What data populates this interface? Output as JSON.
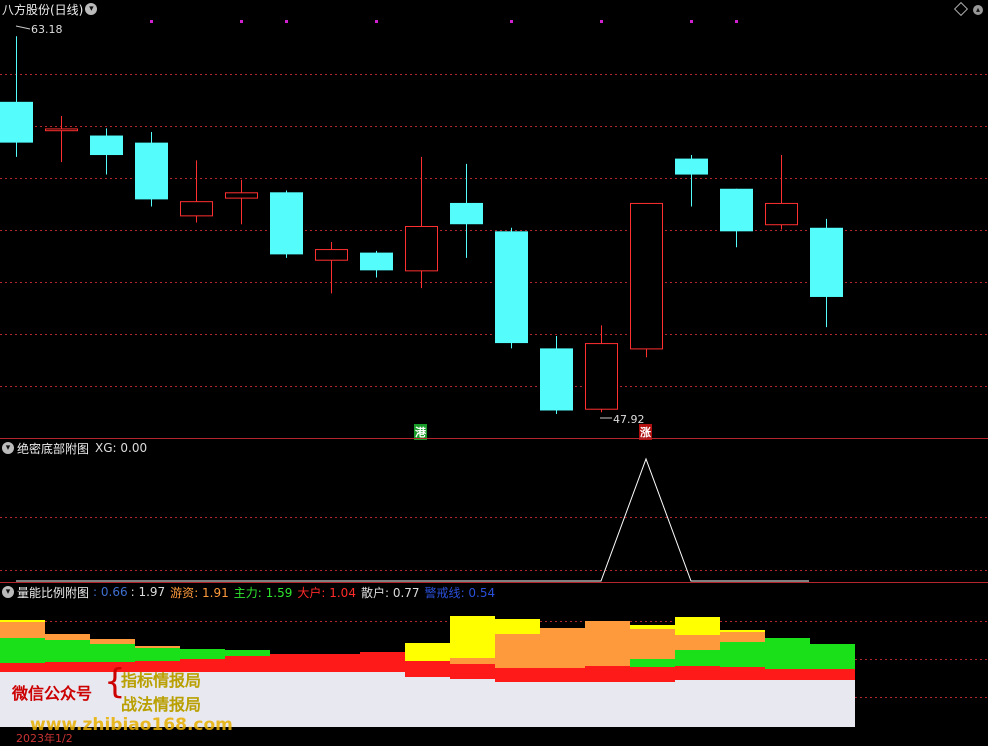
{
  "main_panel": {
    "title": "八方股份(日线)",
    "high_label": "63.18",
    "low_label": "47.92",
    "signal_gang": "港",
    "signal_zhang": "涨"
  },
  "sub_panel_1": {
    "title": "绝密底部附图",
    "xg_label": "XG: 0.00"
  },
  "sub_panel_2": {
    "title": "量能比例附图",
    "values": [
      {
        "label": "",
        "value": "0.66",
        "color": "#3f6fd0"
      },
      {
        "label": "",
        "value": "1.97",
        "color": "#dddddd"
      },
      {
        "label": "游资",
        "value": "1.91",
        "color": "#ff9a3c"
      },
      {
        "label": "主力",
        "value": "1.59",
        "color": "#2ee62e"
      },
      {
        "label": "大户",
        "value": "1.04",
        "color": "#ff2a2a"
      },
      {
        "label": "散户",
        "value": "0.77",
        "color": "#dddddd"
      },
      {
        "label": "警戒线",
        "value": "0.54",
        "color": "#2a4fd8"
      }
    ]
  },
  "watermark": {
    "line1": "微信公众号",
    "brace": "{",
    "line2a": "指标情报局",
    "line2b": "战法情报局",
    "site": "www.zhibiao168.com"
  },
  "date_label": "2023年1/2",
  "chart_data": {
    "type": "candlestick",
    "title": "八方股份(日线)",
    "candles": [
      {
        "open": 57.2,
        "close": 59.5,
        "high": 63.2,
        "low": 56.4,
        "dir": "down"
      },
      {
        "open": 58.0,
        "close": 57.9,
        "high": 58.7,
        "low": 56.1,
        "dir": "up"
      },
      {
        "open": 56.5,
        "close": 57.6,
        "high": 58.0,
        "low": 55.4,
        "dir": "down"
      },
      {
        "open": 54.0,
        "close": 57.2,
        "high": 57.8,
        "low": 53.6,
        "dir": "down"
      },
      {
        "open": 53.1,
        "close": 53.9,
        "high": 56.2,
        "low": 52.7,
        "dir": "up"
      },
      {
        "open": 54.1,
        "close": 54.4,
        "high": 55.1,
        "low": 52.6,
        "dir": "up"
      },
      {
        "open": 50.9,
        "close": 54.4,
        "high": 54.5,
        "low": 50.7,
        "dir": "down"
      },
      {
        "open": 50.6,
        "close": 51.2,
        "high": 51.6,
        "low": 48.7,
        "dir": "up"
      },
      {
        "open": 50.0,
        "close": 51.0,
        "high": 51.1,
        "low": 49.6,
        "dir": "down"
      },
      {
        "open": 50.0,
        "close": 52.5,
        "high": 56.4,
        "low": 49.0,
        "dir": "up"
      },
      {
        "open": 52.6,
        "close": 53.8,
        "high": 56.0,
        "low": 50.7,
        "dir": "down"
      },
      {
        "open": 45.9,
        "close": 52.2,
        "high": 52.4,
        "low": 45.6,
        "dir": "down"
      },
      {
        "open": 42.1,
        "close": 45.6,
        "high": 46.3,
        "low": 41.9,
        "dir": "down"
      },
      {
        "open": 42.2,
        "close": 45.9,
        "high": 46.9,
        "low": 42.0,
        "dir": "up"
      },
      {
        "open": 45.6,
        "close": 53.8,
        "high": 53.8,
        "low": 45.1,
        "dir": "up"
      },
      {
        "open": 55.4,
        "close": 56.3,
        "high": 56.5,
        "low": 53.6,
        "dir": "down"
      },
      {
        "open": 52.2,
        "close": 54.6,
        "high": 54.6,
        "low": 51.3,
        "dir": "down"
      },
      {
        "open": 52.6,
        "close": 53.8,
        "high": 56.5,
        "low": 52.3,
        "dir": "up"
      },
      {
        "open": 48.5,
        "close": 52.4,
        "high": 52.9,
        "low": 46.8,
        "dir": "down"
      }
    ],
    "top_markers": [
      3,
      5,
      6,
      8,
      11,
      13,
      15,
      16
    ]
  },
  "xg_data": [
    0,
    0,
    0,
    0,
    0,
    0,
    0,
    0,
    0,
    0,
    0,
    0,
    0,
    0,
    1,
    0,
    0,
    0
  ],
  "volume_ratio_data": {
    "white": [
      55,
      55,
      55,
      55,
      55,
      55,
      55,
      55,
      55,
      50,
      48,
      45,
      45,
      45,
      45,
      47,
      47,
      47,
      47
    ],
    "red": [
      9,
      10,
      10,
      11,
      13,
      16,
      18,
      18,
      20,
      16,
      15,
      14,
      14,
      16,
      15,
      14,
      13,
      11,
      11
    ],
    "green": [
      25,
      22,
      18,
      13,
      10,
      6,
      0,
      0,
      0,
      0,
      0,
      0,
      0,
      0,
      8,
      16,
      25,
      31,
      25
    ],
    "orange": [
      16,
      6,
      5,
      2,
      0,
      0,
      0,
      0,
      0,
      0,
      6,
      34,
      40,
      45,
      30,
      15,
      10,
      0,
      0
    ],
    "yellow": [
      2,
      0,
      0,
      0,
      0,
      0,
      0,
      0,
      0,
      18,
      42,
      15,
      0,
      0,
      4,
      18,
      2,
      0,
      0
    ]
  },
  "colors": {
    "up_candle": "#ff3030",
    "down_candle": "#54fcfc",
    "grid": "#b3262b",
    "marker": "#d020d0"
  }
}
